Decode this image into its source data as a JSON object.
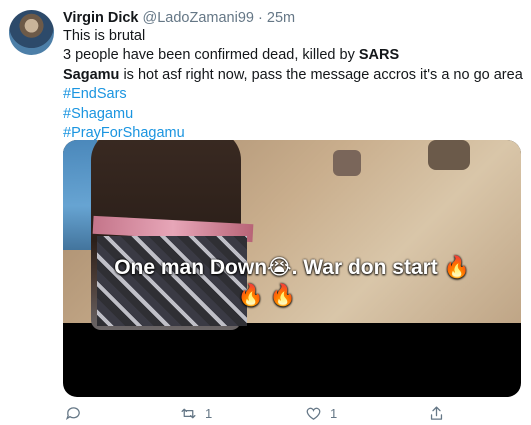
{
  "tweet": {
    "display_name": "Virgin Dick",
    "handle": "@LadoZamani99",
    "separator": "·",
    "time": "25m",
    "lines": [
      "This is brutal",
      "3 people have been confirmed dead, killed by ",
      "Sagamu",
      " is hot asf right now, pass the message accros it's a no go area"
    ],
    "bold_words": [
      "SARS"
    ],
    "hashtags": [
      "#EndSars",
      "#Shagamu",
      "#PrayForShagamu"
    ]
  },
  "media": {
    "caption_line1": "One man Down😭. War don start 🔥",
    "caption_line2": "🔥 🔥"
  },
  "actions": {
    "reply_count": "",
    "retweet_count": "1",
    "like_count": "1",
    "share_count": ""
  },
  "colors": {
    "link": "#1b95e0",
    "muted": "#657786",
    "text": "#14171a"
  },
  "icons": [
    "reply-icon",
    "retweet-icon",
    "like-icon",
    "share-icon"
  ]
}
